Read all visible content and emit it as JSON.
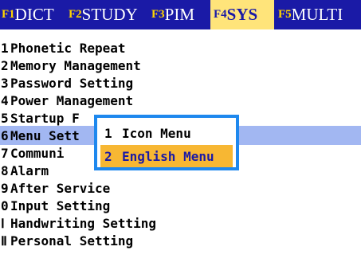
{
  "tabs": [
    {
      "key": "F1",
      "label": "DICT"
    },
    {
      "key": "F2",
      "label": "STUDY"
    },
    {
      "key": "F3",
      "label": " PIM"
    },
    {
      "key": "F4",
      "label": " SYS"
    },
    {
      "key": "F5",
      "label": "MULTI"
    }
  ],
  "menu": {
    "items": [
      {
        "num": "1",
        "label": "Phonetic Repeat"
      },
      {
        "num": "2",
        "label": "Memory Management"
      },
      {
        "num": "3",
        "label": "Password Setting"
      },
      {
        "num": "4",
        "label": "Power Management"
      },
      {
        "num": "5",
        "label": "Startup F"
      },
      {
        "num": "6",
        "label": "Menu Sett"
      },
      {
        "num": "7",
        "label": "Communi"
      },
      {
        "num": "8",
        "label": "Alarm"
      },
      {
        "num": "9",
        "label": "After Service"
      },
      {
        "num": "0",
        "label": "Input Setting"
      },
      {
        "num": "Ⅰ",
        "label": "Handwriting Setting"
      },
      {
        "num": "Ⅱ",
        "label": "Personal Setting"
      }
    ]
  },
  "popup": {
    "items": [
      {
        "num": "1",
        "label": "Icon Menu"
      },
      {
        "num": "2",
        "label": "English Menu"
      }
    ]
  },
  "colors": {
    "tabbar_bg": "#1a1aa6",
    "tab_key": "#ffd400",
    "active_tab_bg": "#ffe47a",
    "menu_selected_bg": "#a2b7f2",
    "popup_border": "#1e88ee",
    "popup_selected_bg": "#f7b733"
  }
}
